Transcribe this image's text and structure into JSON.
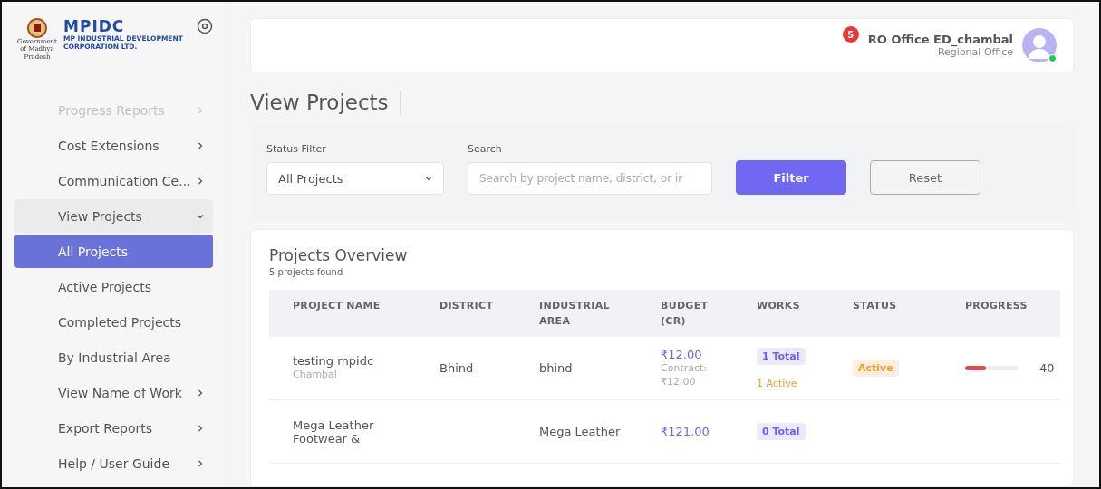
{
  "logo": {
    "emblem_caption": "Government of Madhya Pradesh",
    "wordmark": "MPIDC",
    "line_1": "MP INDUSTRIAL DEVELOPMENT",
    "line_2": "CORPORATION LTD."
  },
  "sidebar": {
    "items": [
      {
        "label": "Progress Reports",
        "kind": "menu",
        "faded": true,
        "selected": false,
        "expanded": false
      },
      {
        "label": "Cost Extensions",
        "kind": "menu",
        "faded": false,
        "selected": false,
        "expanded": false
      },
      {
        "label": "Communication Ce...",
        "kind": "menu",
        "faded": false,
        "selected": false,
        "expanded": false
      },
      {
        "label": "View Projects",
        "kind": "menu",
        "faded": false,
        "selected": false,
        "expanded": true,
        "children": [
          {
            "label": "All Projects",
            "selected": true
          },
          {
            "label": "Active Projects",
            "selected": false
          },
          {
            "label": "Completed Projects",
            "selected": false
          },
          {
            "label": "By Industrial Area",
            "selected": false
          }
        ]
      },
      {
        "label": "View Name of Work",
        "kind": "menu",
        "faded": false,
        "selected": false,
        "expanded": false
      },
      {
        "label": "Export Reports",
        "kind": "menu",
        "faded": false,
        "selected": false,
        "expanded": false
      },
      {
        "label": "Help / User Guide",
        "kind": "menu",
        "faded": false,
        "selected": false,
        "expanded": false
      }
    ]
  },
  "header": {
    "notifications": "5",
    "user_name": "RO Office ED_chambal",
    "user_role": "Regional Office",
    "online": true
  },
  "page_title": "View Projects",
  "filters": {
    "status_label": "Status Filter",
    "status_value": "All Projects",
    "search_label": "Search",
    "search_placeholder": "Search by project name, district, or ir",
    "buttons": [
      {
        "label": "Filter",
        "kind": "primary"
      },
      {
        "label": "Reset",
        "kind": "outline"
      }
    ]
  },
  "overview": {
    "title": "Projects Overview",
    "subtitle": "5 projects found",
    "columns": [
      "PROJECT NAME",
      "DISTRICT",
      "INDUSTRIAL AREA",
      "BUDGET (CR)",
      "WORKS",
      "STATUS",
      "PROGRESS"
    ],
    "rows": [
      {
        "name": "testing mpidc",
        "region": "Chambal",
        "district": "Bhind",
        "area": "bhind",
        "budget": "₹12.00",
        "contract": "Contract: ₹12.00",
        "works_total": "1 Total",
        "works_active": "1 Active",
        "status": "Active",
        "level": 0.4,
        "reading": "40"
      },
      {
        "name": "Mega Leather Footwear &",
        "area": "Mega Leather",
        "budget": "₹121.00",
        "works_total": "0 Total"
      }
    ]
  }
}
